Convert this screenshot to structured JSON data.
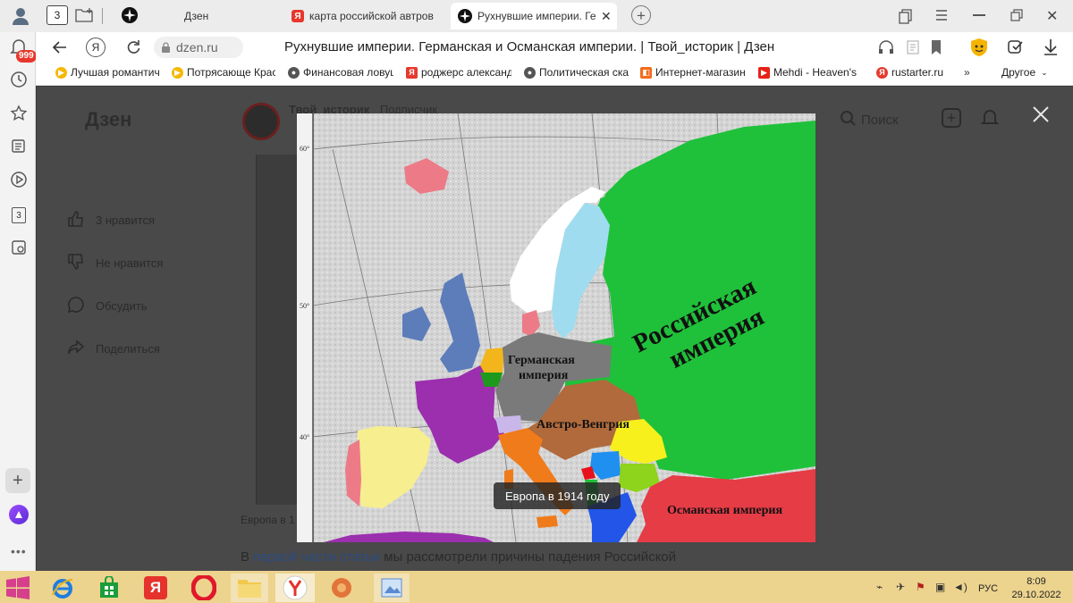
{
  "tabs": {
    "tab_count": "3",
    "items": [
      {
        "label": "Дзен"
      },
      {
        "label": "карта российской автров"
      },
      {
        "label": "Рухнувшие империи. Ге"
      }
    ],
    "new_tab": "+"
  },
  "address": {
    "domain": "dzen.ru",
    "page_title": "Рухнувшие империи. Германская и Османская империи. | Твой_историк | Дзен"
  },
  "bookmarks": {
    "items": [
      {
        "label": "Лучшая романтич",
        "color": "#f5b800"
      },
      {
        "label": "Потрясающе Крас",
        "color": "#f5b800"
      },
      {
        "label": "Финансовая ловуш",
        "color": "#555555"
      },
      {
        "label": "роджерс александ",
        "color": "#e63a2e"
      },
      {
        "label": "Политическая ска",
        "color": "#555555"
      },
      {
        "label": "Интернет-магазин",
        "color": "#f26c1d"
      },
      {
        "label": "Mehdi - Heaven's",
        "color": "#e62117"
      },
      {
        "label": "rustarter.ru",
        "color": "#e63a2e"
      }
    ],
    "more": "»",
    "other": "Другое"
  },
  "sidebar": {
    "badge": "999",
    "count": "3"
  },
  "dzen": {
    "logo": "Дзен",
    "channel": "Твой_историк",
    "channel_sub": "Подписчик",
    "search": "Поиск",
    "like": "3 нравится",
    "dislike": "Не нравится",
    "discuss": "Обсудить",
    "share": "Поделиться",
    "article_prefix": "В",
    "article_link": "первой части статьи",
    "article_rest": "мы рассмотрели причины падения Российской",
    "caption_behind": "Европа в 1"
  },
  "viewer": {
    "caption": "Европа в 1914 году"
  },
  "map": {
    "lat_labels": [
      "60°",
      "50°",
      "40°"
    ],
    "labels": {
      "russia": "Российская империя",
      "germany": "Германская империя",
      "austria": "Австро-Венгрия",
      "ottoman": "Османская империя"
    },
    "colors": {
      "russia": "#1fc13a",
      "germany": "#7a7a7a",
      "austria": "#b06a3c",
      "ottoman": "#e53c46",
      "france": "#9b2fae",
      "uk": "#5c7dba",
      "spain": "#f7ef8f",
      "portugal": "#ec7b87",
      "italy": "#f07b1a",
      "sweden": "#9fdcef",
      "norway": "#ffffff",
      "denmark": "#ec7b87",
      "netherlands": "#f2b61c",
      "belgium": "#1d9a1d",
      "switzerland": "#c9b7ea",
      "serbia": "#1f8ff0",
      "romania": "#f7f01c",
      "bulgaria": "#8ed31c",
      "greece": "#2255e8",
      "montenegro": "#e8101c"
    }
  },
  "taskbar": {
    "lang": "РУС",
    "time": "8:09",
    "date": "29.10.2022"
  }
}
